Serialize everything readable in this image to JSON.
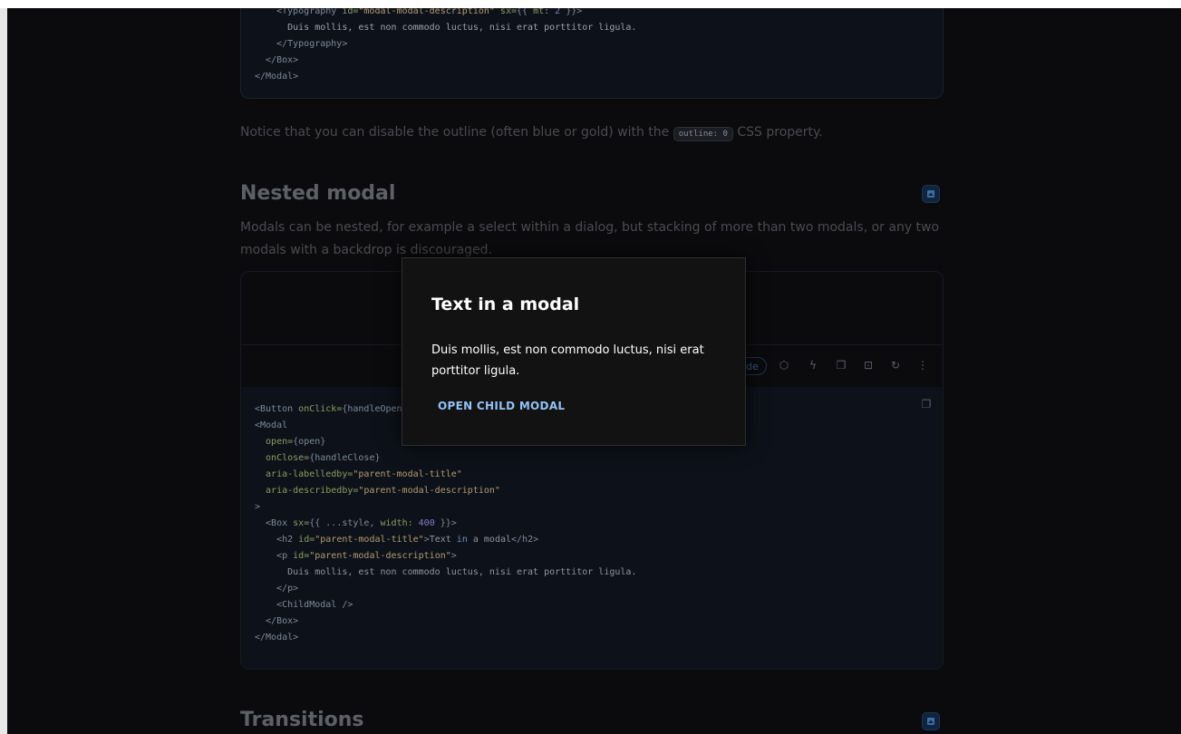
{
  "top_code": [
    {
      "parts": [
        [
          "tag",
          "    <Typography "
        ],
        [
          "attr",
          "id="
        ],
        [
          "str",
          "\"modal-modal-description\""
        ],
        [
          "attr",
          " sx="
        ],
        [
          "tag",
          "{{ "
        ],
        [
          "attr",
          "mt: "
        ],
        [
          "num",
          "2"
        ],
        [
          "tag",
          " }}>"
        ]
      ]
    },
    {
      "parts": [
        [
          "txt",
          "      Duis mollis, est non commodo luctus, nisi erat porttitor ligula."
        ]
      ]
    },
    {
      "parts": [
        [
          "tag",
          "    </Typography>"
        ]
      ]
    },
    {
      "parts": [
        [
          "tag",
          "  </Box>"
        ]
      ]
    },
    {
      "parts": [
        [
          "tag",
          "</Modal>"
        ]
      ]
    }
  ],
  "notice_text_before": "Notice that you can disable the outline (often blue or gold) with the ",
  "notice_code": "outline: 0",
  "notice_text_after": " CSS property.",
  "nested_heading": "Nested modal",
  "nested_desc": "Modals can be nested, for example a select within a dialog, but stacking of more than two modals, or any two modals with a backdrop is discouraged.",
  "toolbar": {
    "code_pill": "de",
    "icons": [
      "codesandbox-icon",
      "stackblitz-icon",
      "copy-icon",
      "focus-icon",
      "reset-icon",
      "more-icon"
    ]
  },
  "demo_code": [
    {
      "parts": [
        [
          "tag",
          "<Button "
        ],
        [
          "attr",
          "onClick="
        ],
        [
          "tag",
          "{handleOpen}>"
        ]
      ]
    },
    {
      "parts": [
        [
          "tag",
          "<Modal"
        ]
      ]
    },
    {
      "parts": [
        [
          "attr",
          "  open="
        ],
        [
          "tag",
          "{open}"
        ]
      ]
    },
    {
      "parts": [
        [
          "attr",
          "  onClose="
        ],
        [
          "tag",
          "{handleClose}"
        ]
      ]
    },
    {
      "parts": [
        [
          "attr",
          "  aria-labelledby="
        ],
        [
          "str",
          "\"parent-modal-title\""
        ]
      ]
    },
    {
      "parts": [
        [
          "attr",
          "  aria-describedby="
        ],
        [
          "str",
          "\"parent-modal-description\""
        ]
      ]
    },
    {
      "parts": [
        [
          "tag",
          ">"
        ]
      ]
    },
    {
      "parts": [
        [
          "tag",
          "  <Box "
        ],
        [
          "attr",
          "sx="
        ],
        [
          "tag",
          "{{ ...style, "
        ],
        [
          "attr",
          "width: "
        ],
        [
          "num",
          "400"
        ],
        [
          "tag",
          " }}>"
        ]
      ]
    },
    {
      "parts": [
        [
          "tag",
          "    <h2 "
        ],
        [
          "attr",
          "id="
        ],
        [
          "str",
          "\"parent-modal-title\""
        ],
        [
          "tag",
          ">"
        ],
        [
          "txt",
          "Text "
        ],
        [
          "kw",
          "in"
        ],
        [
          "txt",
          " a modal"
        ],
        [
          "tag",
          "</h2>"
        ]
      ]
    },
    {
      "parts": [
        [
          "tag",
          "    <p "
        ],
        [
          "attr",
          "id="
        ],
        [
          "str",
          "\"parent-modal-description\""
        ],
        [
          "tag",
          ">"
        ]
      ]
    },
    {
      "parts": [
        [
          "txt",
          "      Duis mollis, est non commodo luctus, nisi erat porttitor ligula."
        ]
      ]
    },
    {
      "parts": [
        [
          "tag",
          "    </p>"
        ]
      ]
    },
    {
      "parts": [
        [
          "tag",
          "    <ChildModal />"
        ]
      ]
    },
    {
      "parts": [
        [
          "tag",
          "  </Box>"
        ]
      ]
    },
    {
      "parts": [
        [
          "tag",
          "</Modal>"
        ]
      ]
    }
  ],
  "transitions_heading": "Transitions",
  "modal": {
    "title": "Text in a modal",
    "description": "Duis mollis, est non commodo luctus, nisi erat porttitor ligula.",
    "button_label": "OPEN CHILD MODAL"
  },
  "colors": {
    "accent": "#90c2f5",
    "backdrop": "#0b0b0d",
    "modal_bg": "#121212"
  }
}
